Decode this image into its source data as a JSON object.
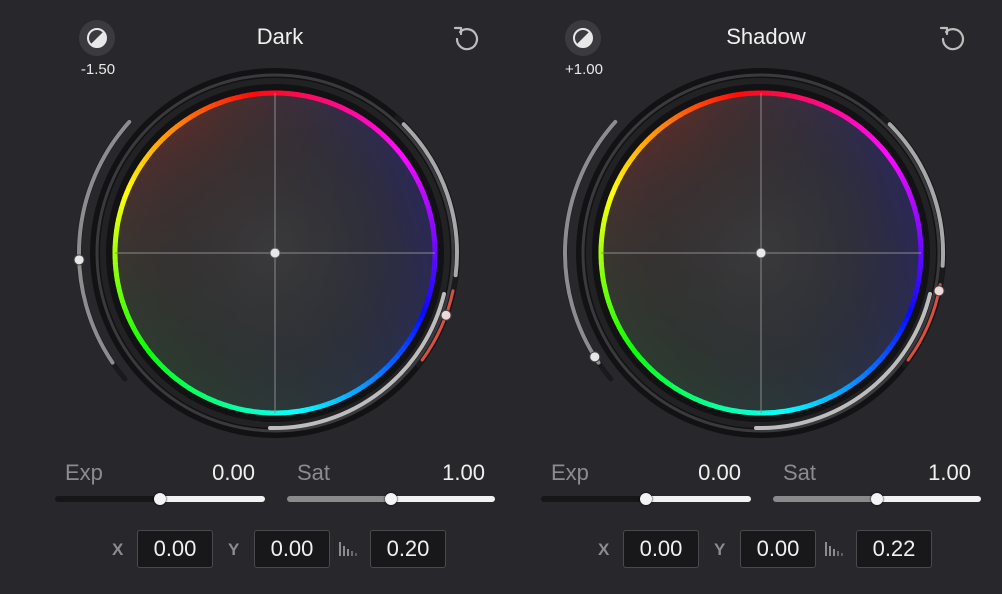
{
  "colors": {
    "background": "#28282c",
    "field_bg": "#18181a",
    "label_gray": "#8c8c8f",
    "text_white": "#f0f0f0",
    "sat_ring": "#d95040"
  },
  "panels": [
    {
      "title": "Dark",
      "contrast_value": "-1.50",
      "contrast_icon": "contrast-icon",
      "reset_icon": "reset-icon",
      "exp_label": "Exp",
      "exp_value": "0.00",
      "exp_position": 0.5,
      "sat_label": "Sat",
      "sat_value": "1.00",
      "sat_position": 0.5,
      "x_label": "X",
      "x_value": "0.00",
      "y_label": "Y",
      "y_value": "0.00",
      "lum_icon": "luminance-range-icon",
      "lum_value": "0.20"
    },
    {
      "title": "Shadow",
      "contrast_value": "+1.00",
      "contrast_icon": "contrast-icon",
      "reset_icon": "reset-icon",
      "exp_label": "Exp",
      "exp_value": "0.00",
      "exp_position": 0.5,
      "sat_label": "Sat",
      "sat_value": "1.00",
      "sat_position": 0.5,
      "x_label": "X",
      "x_value": "0.00",
      "y_label": "Y",
      "y_value": "0.00",
      "lum_icon": "luminance-range-icon",
      "lum_value": "0.22"
    }
  ]
}
